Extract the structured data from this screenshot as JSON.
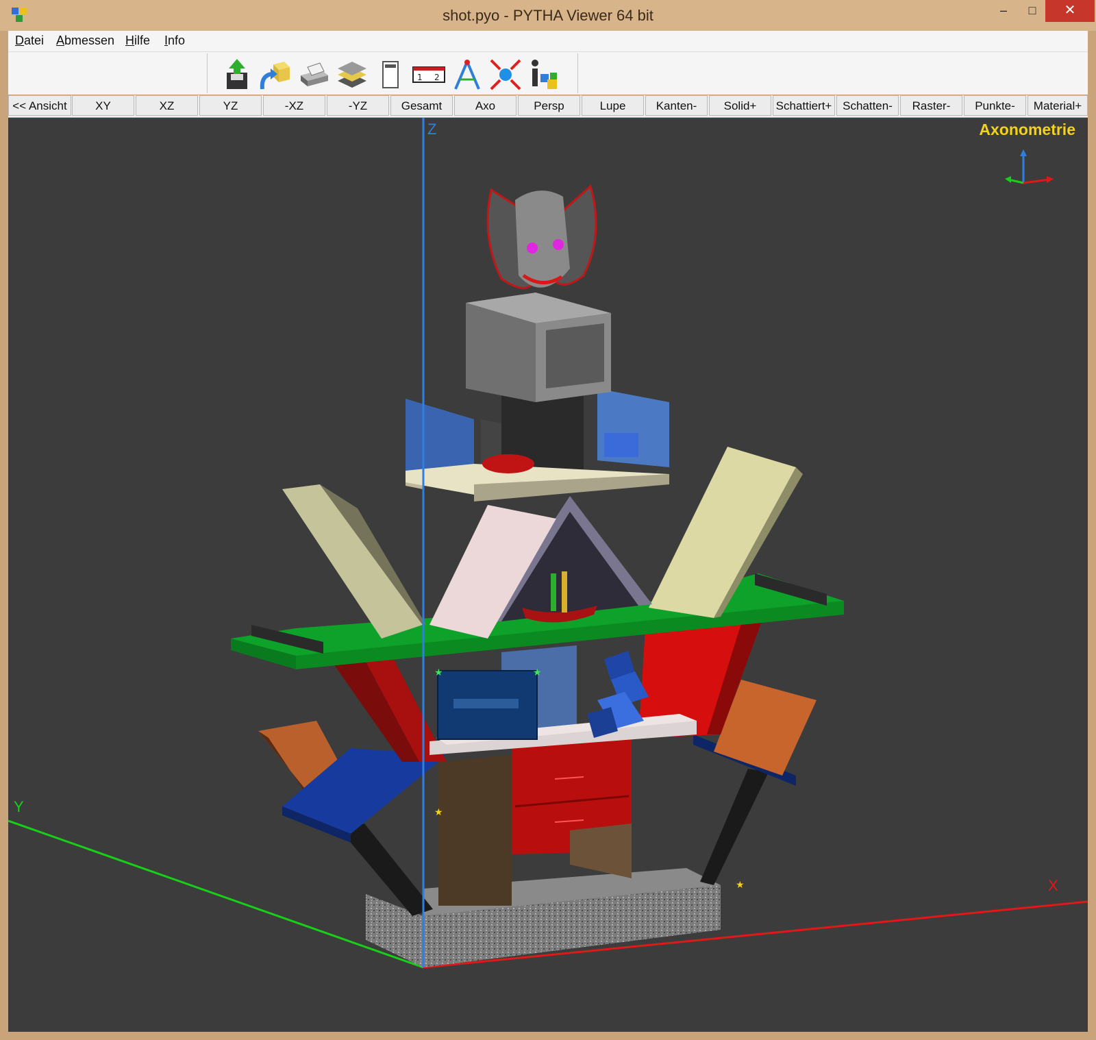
{
  "window": {
    "title": "shot.pyo - PYTHA Viewer 64 bit",
    "minimize_glyph": "–",
    "maximize_glyph": "□",
    "close_glyph": "✕"
  },
  "menu": {
    "items": [
      {
        "key": "D",
        "rest": "atei"
      },
      {
        "key": "A",
        "rest": "bmessen"
      },
      {
        "key": "H",
        "rest": "ilfe"
      },
      {
        "key": "I",
        "rest": "nfo"
      }
    ]
  },
  "toolbar": {
    "icons": [
      "save-icon",
      "export-icon",
      "print-icon",
      "layers-icon",
      "window-icon",
      "measure-icon",
      "compass-icon",
      "explode-icon",
      "properties-icon"
    ]
  },
  "viewbar": {
    "buttons": [
      "<< Ansicht",
      "XY",
      "XZ",
      "YZ",
      "-XZ",
      "-YZ",
      "Gesamt",
      "Axo",
      "Persp",
      "Lupe",
      "Kanten-",
      "Solid+",
      "Schattiert+",
      "Schatten-",
      "Raster-",
      "Punkte-",
      "Material+"
    ]
  },
  "viewport": {
    "view_name": "Axonometrie",
    "axis_x": "X",
    "axis_y": "Y",
    "axis_z": "Z",
    "colors": {
      "background": "#3c3c3c",
      "x_axis": "#e01818",
      "y_axis": "#18d018",
      "z_axis": "#2f7fe0",
      "label": "#f2d21c"
    }
  }
}
